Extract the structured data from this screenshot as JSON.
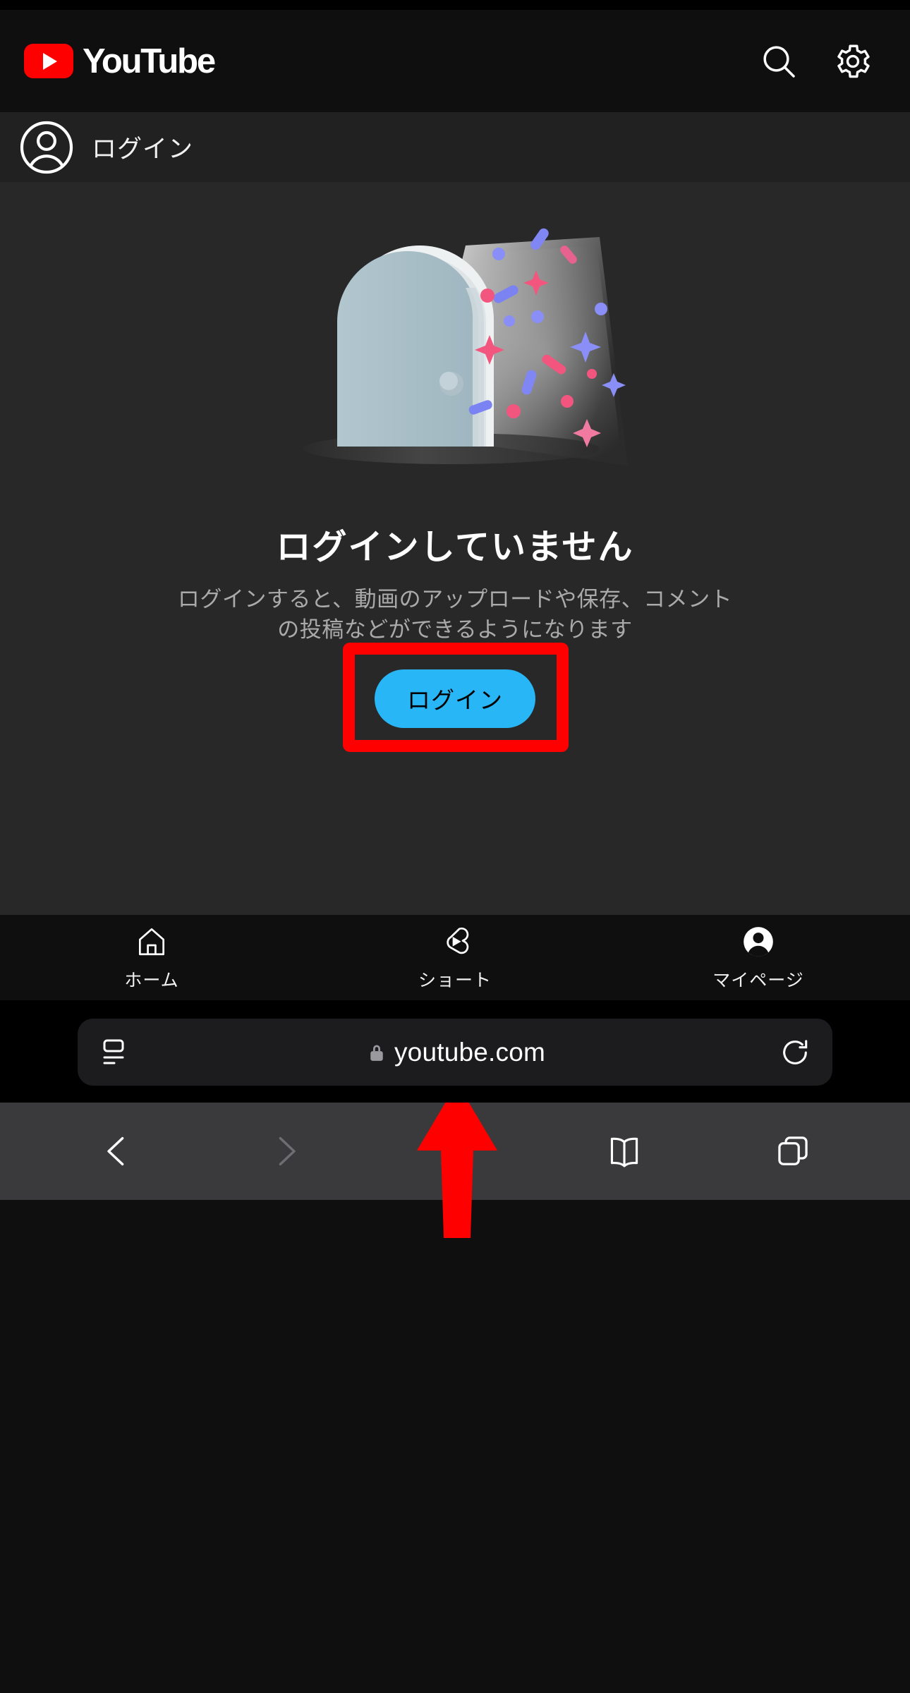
{
  "colors": {
    "brand_red": "#FF0000",
    "header_bg": "#0f0f0f",
    "login_row_bg": "#212121",
    "body_bg": "#282828",
    "button_blue": "#29B6F6",
    "annotation_red": "#FF0000",
    "muted_text": "#aaaaaa",
    "safari_toolbar_bg": "#3a3a3c"
  },
  "header": {
    "logo_text": "YouTube",
    "logo_icon": "youtube-play-icon",
    "search_icon": "search-icon",
    "settings_icon": "gear-icon"
  },
  "account_row": {
    "avatar_icon": "account-circle-icon",
    "label": "ログイン"
  },
  "main": {
    "illustration_name": "open-door-confetti-illustration",
    "headline": "ログインしていません",
    "description": "ログインすると、動画のアップロードや保存、コメントの投稿などができるようになります",
    "login_button_label": "ログイン",
    "annotation": {
      "highlight_box": "red-rectangle-highlight",
      "arrow": "red-up-arrow"
    }
  },
  "tabbar": {
    "items": [
      {
        "label": "ホーム",
        "icon": "home-icon"
      },
      {
        "label": "ショート",
        "icon": "shorts-icon"
      },
      {
        "label": "マイページ",
        "icon": "account-filled-icon"
      }
    ]
  },
  "browser": {
    "aa_icon": "page-settings-icon",
    "lock_icon": "lock-icon",
    "domain": "youtube.com",
    "reload_icon": "reload-icon",
    "toolbar": [
      {
        "icon": "back-chevron-icon",
        "name": "back-button"
      },
      {
        "icon": "forward-chevron-icon",
        "name": "forward-button"
      },
      {
        "icon": "share-icon",
        "name": "share-button"
      },
      {
        "icon": "bookmarks-icon",
        "name": "bookmarks-button"
      },
      {
        "icon": "tabs-icon",
        "name": "tabs-button"
      }
    ]
  }
}
